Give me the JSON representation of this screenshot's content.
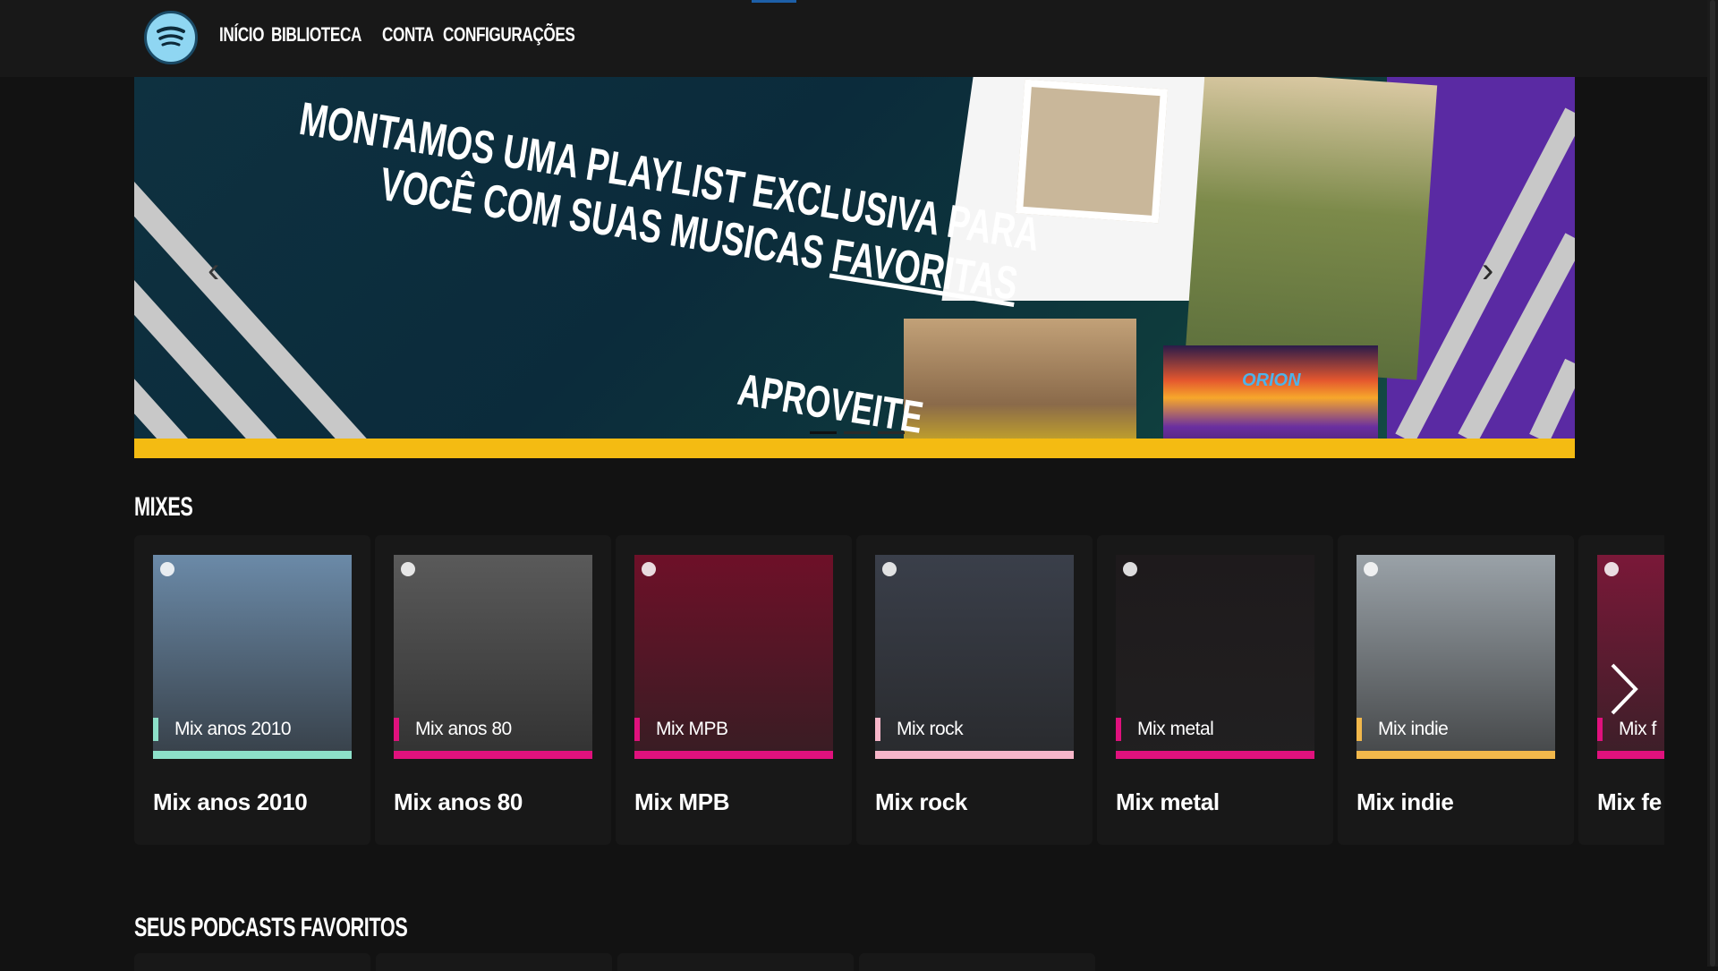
{
  "nav": {
    "items": [
      "INÍCIO",
      "BIBLIOTECA",
      "CONTA",
      "CONFIGURAÇÕES"
    ]
  },
  "hero": {
    "line1": "MONTAMOS UMA PLAYLIST EXCLUSIVA PARA",
    "line2_a": "VOCÊ COM SUAS MUSICAS ",
    "line2_b": "FAVORITAS",
    "cta": "APROVEITE",
    "art_text": "ORION"
  },
  "sections": {
    "mixes": "MIXES",
    "podcasts": "SEUS PODCASTS FAVORITOS"
  },
  "mixes": [
    {
      "label": "Mix anos 2010",
      "title": "Mix anos 2010",
      "accent": "#8de0c9",
      "art_bg": "#6b8aa8"
    },
    {
      "label": "Mix anos 80",
      "title": "Mix anos 80",
      "accent": "#e0117d",
      "art_bg": "#5a5a5a"
    },
    {
      "label": "Mix MPB",
      "title": "Mix MPB",
      "accent": "#e0117d",
      "art_bg": "#6e1028"
    },
    {
      "label": "Mix rock",
      "title": "Mix rock",
      "accent": "#f7b6c9",
      "art_bg": "#3a3f4a"
    },
    {
      "label": "Mix metal",
      "title": "Mix metal",
      "accent": "#e0117d",
      "art_bg": "#1e1a1c"
    },
    {
      "label": "Mix indie",
      "title": "Mix indie",
      "accent": "#f2b84b",
      "art_bg": "#9aa2a8"
    },
    {
      "label": "Mix f",
      "title": "Mix fe",
      "accent": "#e0117d",
      "art_bg": "#7a1838"
    }
  ]
}
